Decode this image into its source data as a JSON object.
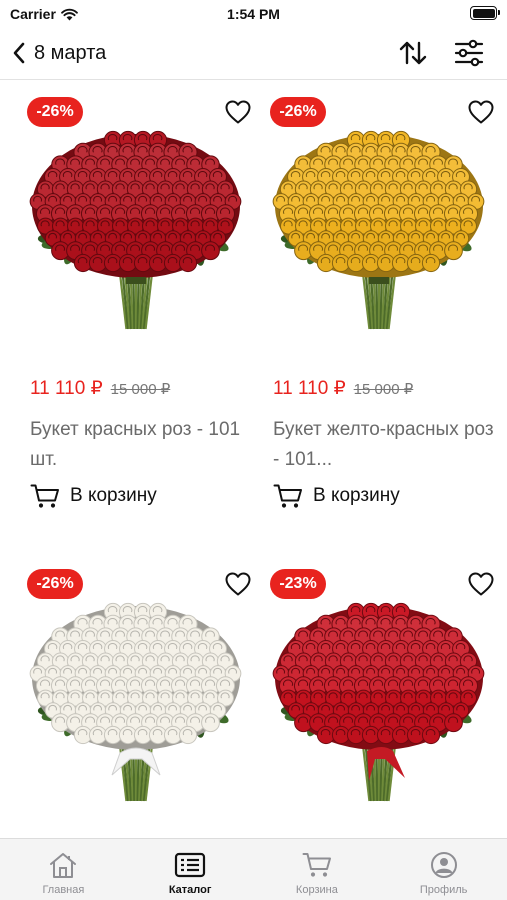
{
  "status_bar": {
    "carrier": "Carrier",
    "time": "1:54 PM"
  },
  "nav": {
    "title": "8 марта",
    "icons": [
      "chevron-left-icon",
      "sort-icon",
      "filter-icon"
    ]
  },
  "products": [
    {
      "discount": "-26%",
      "price": "11 110 ₽",
      "old_price": "15 000 ₽",
      "name": "Букет красных роз - 101 шт.",
      "cart_label": "В корзину",
      "image": "red-roses-bouquet",
      "rose_color": "#b3111c"
    },
    {
      "discount": "-26%",
      "price": "11 110 ₽",
      "old_price": "15 000 ₽",
      "name": "Букет желто-красных роз - 101...",
      "cart_label": "В корзину",
      "image": "yellow-red-roses-bouquet",
      "rose_color": "#f2b51f"
    },
    {
      "discount": "-26%",
      "image": "white-roses-bouquet",
      "rose_color": "#f4f1e8"
    },
    {
      "discount": "-23%",
      "image": "red-roses-greenery-bouquet",
      "rose_color": "#c8121f"
    }
  ],
  "tabs": [
    {
      "label": "Главная",
      "icon": "home-icon",
      "active": false
    },
    {
      "label": "Каталог",
      "icon": "catalog-icon",
      "active": true
    },
    {
      "label": "Корзина",
      "icon": "cart-icon",
      "active": false
    },
    {
      "label": "Профиль",
      "icon": "profile-icon",
      "active": false
    }
  ],
  "colors": {
    "accent": "#e8231e",
    "text_muted": "#6b6b6b",
    "tab_inactive": "#8e8e93"
  }
}
